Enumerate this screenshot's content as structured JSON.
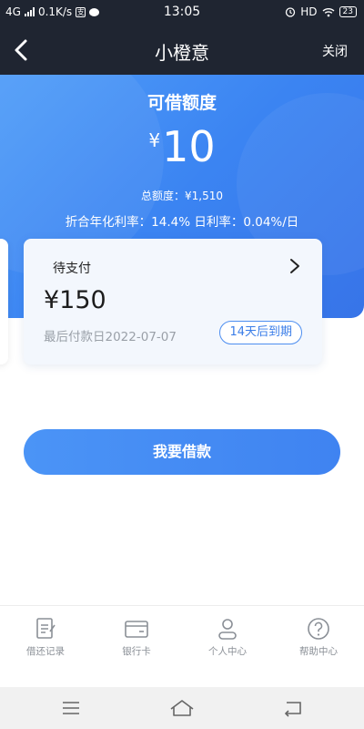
{
  "status_bar": {
    "network": "4G",
    "speed": "0.1K/s",
    "time": "13:05",
    "hd": "HD",
    "battery": "23",
    "badge": "支"
  },
  "header": {
    "title": "小橙意",
    "close_label": "关闭"
  },
  "credit": {
    "available_label": "可借额度",
    "currency_symbol": "¥",
    "available_amount": "10",
    "total_line": "总额度：¥1,510",
    "rate_line": "折合年化利率：14.4%  日利率：0.04%/日"
  },
  "payment_card": {
    "label": "待支付",
    "amount": "¥150",
    "due_date_text": "最后付款日2022-07-07",
    "badge_text": "14天后到期"
  },
  "borrow_button": {
    "label": "我要借款"
  },
  "tab_bar": {
    "items": [
      {
        "label": "借还记录",
        "icon": "record-icon"
      },
      {
        "label": "银行卡",
        "icon": "bank-card-icon"
      },
      {
        "label": "个人中心",
        "icon": "person-icon"
      },
      {
        "label": "帮助中心",
        "icon": "help-icon"
      }
    ]
  },
  "system_nav": {
    "icons": [
      "menu-icon",
      "home-icon",
      "back-nav-icon"
    ]
  },
  "colors": {
    "header_bg": "#1f2531",
    "hero_blue": "#3b84f2",
    "accent": "#3a7de8",
    "muted_text": "#9aa0a8"
  }
}
